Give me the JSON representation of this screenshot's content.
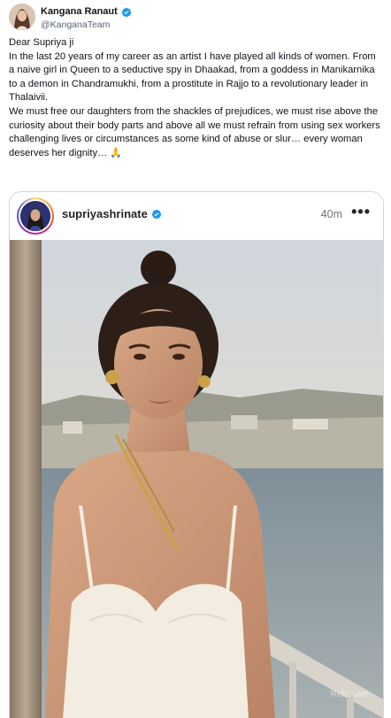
{
  "tweet": {
    "display_name": "Kangana Ranaut",
    "handle": "@KanganaTeam",
    "paragraphs": [
      "Dear Supriya ji",
      "In the last 20 years of my career as an artist I have played all kinds of women. From a naive girl in Queen to a seductive spy in Dhaakad, from a goddess in Manikarnika to a demon in Chandramukhi, from a prostitute in Rajjo to a revolutionary leader in Thalaivii.",
      "We must free our daughters from the shackles of prejudices, we must rise above the curiosity about their body parts and above all we must refrain from using sex workers challenging lives or circumstances as some kind of abuse or slur… every woman deserves her dignity…"
    ],
    "emoji": "🙏"
  },
  "quote": {
    "username": "supriyashrinate",
    "time": "40m",
    "more": "•••",
    "watermark": "Retrocam"
  },
  "colors": {
    "verified_blue": "#1d9bf0",
    "text_secondary": "#536471",
    "border": "#cfd9de"
  },
  "icons": {
    "verified": "verified-badge-icon",
    "more": "more-options-icon"
  }
}
